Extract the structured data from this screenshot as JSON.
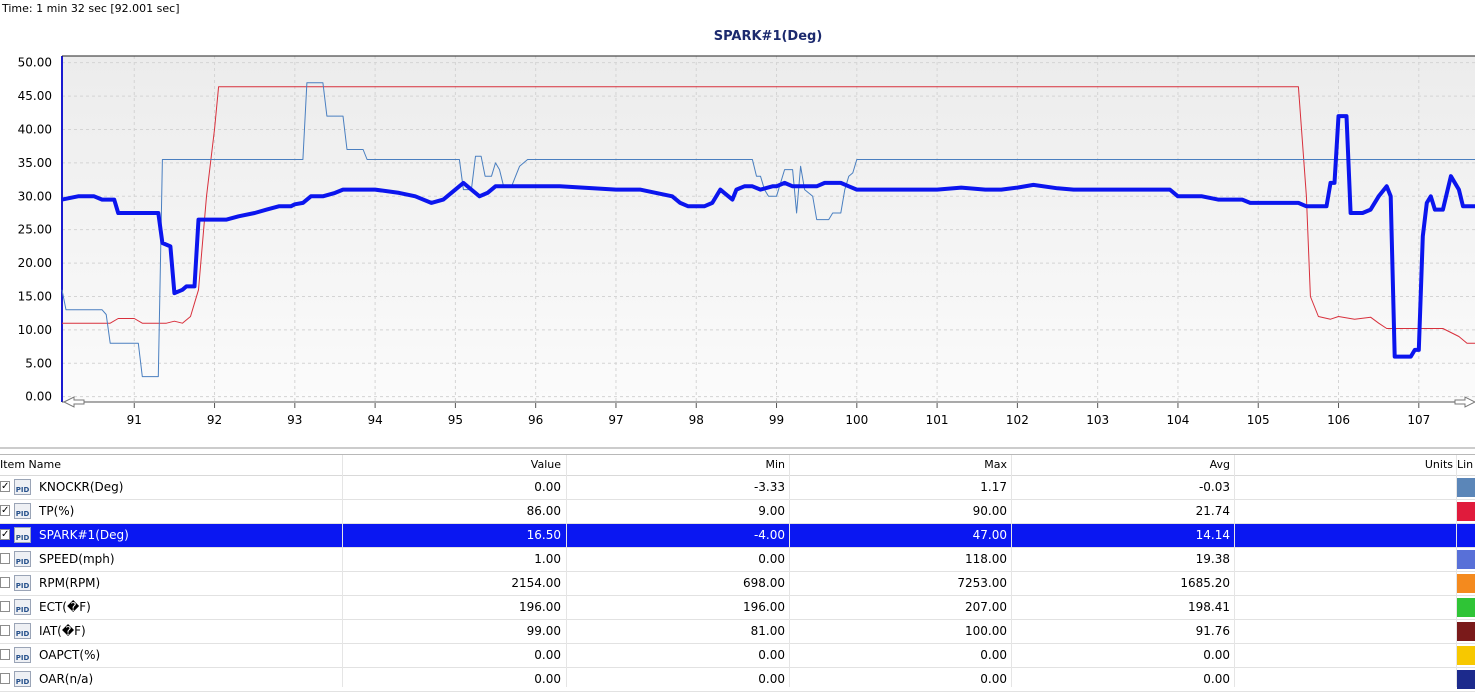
{
  "time_label": "Time: 1 min 32 sec [92.001 sec]",
  "chart_data": {
    "type": "line",
    "title": "SPARK#1(Deg)",
    "xlim": [
      90.1,
      107.7
    ],
    "ylim": [
      -0.8,
      51
    ],
    "x_ticks": [
      "91",
      "92",
      "93",
      "94",
      "95",
      "96",
      "97",
      "98",
      "99",
      "100",
      "101",
      "102",
      "103",
      "104",
      "105",
      "106",
      "107"
    ],
    "y_ticks": [
      "50.00",
      "45.00",
      "40.00",
      "35.00",
      "30.00",
      "25.00",
      "20.00",
      "15.00",
      "10.00",
      "5.00",
      "0.00"
    ],
    "grid": true,
    "series": [
      {
        "name": "TP(%)",
        "color": "#d8303c",
        "width": 1,
        "points": [
          [
            90.1,
            11
          ],
          [
            90.7,
            11
          ],
          [
            90.8,
            11.7
          ],
          [
            91.0,
            11.7
          ],
          [
            91.1,
            11
          ],
          [
            91.4,
            11
          ],
          [
            91.5,
            11.3
          ],
          [
            91.6,
            11
          ],
          [
            91.7,
            12
          ],
          [
            91.8,
            16
          ],
          [
            91.9,
            30
          ],
          [
            92.0,
            40
          ],
          [
            92.05,
            46.4
          ],
          [
            105.5,
            46.4
          ],
          [
            105.6,
            30
          ],
          [
            105.65,
            15
          ],
          [
            105.75,
            12
          ],
          [
            105.9,
            11.6
          ],
          [
            106.0,
            12
          ],
          [
            106.2,
            11.6
          ],
          [
            106.4,
            11.9
          ],
          [
            106.5,
            11
          ],
          [
            106.6,
            10.2
          ],
          [
            107.3,
            10.2
          ],
          [
            107.5,
            9
          ],
          [
            107.6,
            8
          ],
          [
            107.7,
            8
          ]
        ]
      },
      {
        "name": "KNOCKR(Deg)",
        "color": "#4a7fc0",
        "width": 1,
        "points": [
          [
            90.1,
            16
          ],
          [
            90.15,
            13
          ],
          [
            90.6,
            13
          ],
          [
            90.65,
            12.3
          ],
          [
            90.7,
            8
          ],
          [
            91.05,
            8
          ],
          [
            91.1,
            3
          ],
          [
            91.3,
            3
          ],
          [
            91.35,
            35.5
          ],
          [
            93.1,
            35.5
          ],
          [
            93.15,
            47
          ],
          [
            93.35,
            47
          ],
          [
            93.4,
            42
          ],
          [
            93.6,
            42
          ],
          [
            93.65,
            37
          ],
          [
            93.85,
            37
          ],
          [
            93.9,
            35.5
          ],
          [
            95.05,
            35.5
          ],
          [
            95.1,
            31
          ],
          [
            95.2,
            31
          ],
          [
            95.25,
            36
          ],
          [
            95.32,
            36
          ],
          [
            95.37,
            33
          ],
          [
            95.45,
            33
          ],
          [
            95.5,
            35
          ],
          [
            95.55,
            34
          ],
          [
            95.6,
            31.5
          ],
          [
            95.7,
            31.5
          ],
          [
            95.75,
            33
          ],
          [
            95.8,
            34.5
          ],
          [
            95.9,
            35.5
          ],
          [
            98.7,
            35.5
          ],
          [
            98.75,
            33
          ],
          [
            98.8,
            33
          ],
          [
            98.85,
            31
          ],
          [
            98.9,
            30
          ],
          [
            99.0,
            30
          ],
          [
            99.1,
            34
          ],
          [
            99.2,
            34
          ],
          [
            99.25,
            27.5
          ],
          [
            99.3,
            34.5
          ],
          [
            99.35,
            31
          ],
          [
            99.45,
            30
          ],
          [
            99.5,
            26.5
          ],
          [
            99.65,
            26.5
          ],
          [
            99.7,
            27.5
          ],
          [
            99.8,
            27.5
          ],
          [
            99.85,
            31
          ],
          [
            99.9,
            33
          ],
          [
            99.95,
            33.5
          ],
          [
            100.0,
            35.5
          ],
          [
            107.7,
            35.5
          ]
        ]
      },
      {
        "name": "SPARK#1(Deg)",
        "color": "#0b15ee",
        "width": 4,
        "points": [
          [
            90.1,
            29.5
          ],
          [
            90.3,
            30
          ],
          [
            90.5,
            30
          ],
          [
            90.6,
            29.5
          ],
          [
            90.75,
            29.5
          ],
          [
            90.8,
            27.5
          ],
          [
            91.3,
            27.5
          ],
          [
            91.35,
            23
          ],
          [
            91.45,
            22.5
          ],
          [
            91.5,
            15.5
          ],
          [
            91.6,
            16
          ],
          [
            91.65,
            16.5
          ],
          [
            91.75,
            16.5
          ],
          [
            91.8,
            26.5
          ],
          [
            92.15,
            26.5
          ],
          [
            92.3,
            27
          ],
          [
            92.5,
            27.5
          ],
          [
            92.65,
            28
          ],
          [
            92.8,
            28.5
          ],
          [
            92.95,
            28.5
          ],
          [
            93.0,
            28.8
          ],
          [
            93.1,
            29
          ],
          [
            93.2,
            30
          ],
          [
            93.35,
            30
          ],
          [
            93.5,
            30.5
          ],
          [
            93.6,
            31
          ],
          [
            94.0,
            31
          ],
          [
            94.3,
            30.5
          ],
          [
            94.5,
            30
          ],
          [
            94.7,
            29
          ],
          [
            94.85,
            29.5
          ],
          [
            95.0,
            31
          ],
          [
            95.1,
            32
          ],
          [
            95.2,
            31
          ],
          [
            95.3,
            30
          ],
          [
            95.4,
            30.5
          ],
          [
            95.5,
            31.5
          ],
          [
            96.3,
            31.5
          ],
          [
            97.0,
            31
          ],
          [
            97.3,
            31
          ],
          [
            97.5,
            30.5
          ],
          [
            97.7,
            30
          ],
          [
            97.8,
            29
          ],
          [
            97.9,
            28.5
          ],
          [
            98.1,
            28.5
          ],
          [
            98.2,
            29
          ],
          [
            98.3,
            31
          ],
          [
            98.35,
            30.5
          ],
          [
            98.4,
            30
          ],
          [
            98.45,
            29.5
          ],
          [
            98.5,
            31
          ],
          [
            98.6,
            31.5
          ],
          [
            98.7,
            31.5
          ],
          [
            98.8,
            31
          ],
          [
            98.95,
            31.5
          ],
          [
            99.0,
            31.5
          ],
          [
            99.1,
            32
          ],
          [
            99.2,
            31.5
          ],
          [
            99.5,
            31.5
          ],
          [
            99.6,
            32
          ],
          [
            99.8,
            32
          ],
          [
            99.9,
            31.5
          ],
          [
            100.0,
            31
          ],
          [
            100.3,
            31
          ],
          [
            101.0,
            31
          ],
          [
            101.3,
            31.3
          ],
          [
            101.6,
            31
          ],
          [
            101.8,
            31
          ],
          [
            102.0,
            31.3
          ],
          [
            102.2,
            31.7
          ],
          [
            102.5,
            31.2
          ],
          [
            102.7,
            31
          ],
          [
            103.9,
            31
          ],
          [
            104.0,
            30
          ],
          [
            104.3,
            30
          ],
          [
            104.5,
            29.5
          ],
          [
            104.8,
            29.5
          ],
          [
            104.9,
            29
          ],
          [
            105.0,
            29
          ],
          [
            105.5,
            29
          ],
          [
            105.6,
            28.5
          ],
          [
            105.85,
            28.5
          ],
          [
            105.9,
            32
          ],
          [
            105.95,
            32
          ],
          [
            106.0,
            42
          ],
          [
            106.1,
            42
          ],
          [
            106.15,
            27.5
          ],
          [
            106.3,
            27.5
          ],
          [
            106.4,
            28
          ],
          [
            106.5,
            30
          ],
          [
            106.6,
            31.5
          ],
          [
            106.65,
            30
          ],
          [
            106.7,
            6
          ],
          [
            106.9,
            6
          ],
          [
            106.95,
            7
          ],
          [
            107.0,
            7
          ],
          [
            107.05,
            24
          ],
          [
            107.1,
            29
          ],
          [
            107.15,
            30
          ],
          [
            107.2,
            28
          ],
          [
            107.3,
            28
          ],
          [
            107.35,
            30.5
          ],
          [
            107.4,
            33
          ],
          [
            107.5,
            31
          ],
          [
            107.55,
            28.5
          ],
          [
            107.7,
            28.5
          ]
        ]
      }
    ],
    "x_tail": "107",
    "scroll": "arrows"
  },
  "table": {
    "headers": {
      "name": "Item Name",
      "value": "Value",
      "min": "Min",
      "max": "Max",
      "avg": "Avg",
      "units": "Units",
      "line": "Lin"
    },
    "rows": [
      {
        "checked": "✓",
        "name": "KNOCKR(Deg)",
        "value": "0.00",
        "min": "-3.33",
        "max": "1.17",
        "avg": "-0.03",
        "color": "#5b86b8",
        "selected": false
      },
      {
        "checked": "✓",
        "name": "TP(%)",
        "value": "86.00",
        "min": "9.00",
        "max": "90.00",
        "avg": "21.74",
        "color": "#e01b3c",
        "selected": false
      },
      {
        "checked": "✓",
        "name": "SPARK#1(Deg)",
        "value": "16.50",
        "min": "-4.00",
        "max": "47.00",
        "avg": "14.14",
        "color": "#0a17f2",
        "selected": true
      },
      {
        "checked": "",
        "name": "SPEED(mph)",
        "value": "1.00",
        "min": "0.00",
        "max": "118.00",
        "avg": "19.38",
        "color": "#5870d8",
        "selected": false
      },
      {
        "checked": "",
        "name": "RPM(RPM)",
        "value": "2154.00",
        "min": "698.00",
        "max": "7253.00",
        "avg": "1685.20",
        "color": "#f48a1e",
        "selected": false
      },
      {
        "checked": "",
        "name": "ECT(�F)",
        "value": "196.00",
        "min": "196.00",
        "max": "207.00",
        "avg": "198.41",
        "color": "#2fc436",
        "selected": false
      },
      {
        "checked": "",
        "name": "IAT(�F)",
        "value": "99.00",
        "min": "81.00",
        "max": "100.00",
        "avg": "91.76",
        "color": "#7a1a1a",
        "selected": false
      },
      {
        "checked": "",
        "name": "OAPCT(%)",
        "value": "0.00",
        "min": "0.00",
        "max": "0.00",
        "avg": "0.00",
        "color": "#f7c800",
        "selected": false
      },
      {
        "checked": "",
        "name": "OAR(n/a)",
        "value": "0.00",
        "min": "0.00",
        "max": "0.00",
        "avg": "0.00",
        "color": "#1c2a8c",
        "selected": false
      }
    ]
  }
}
